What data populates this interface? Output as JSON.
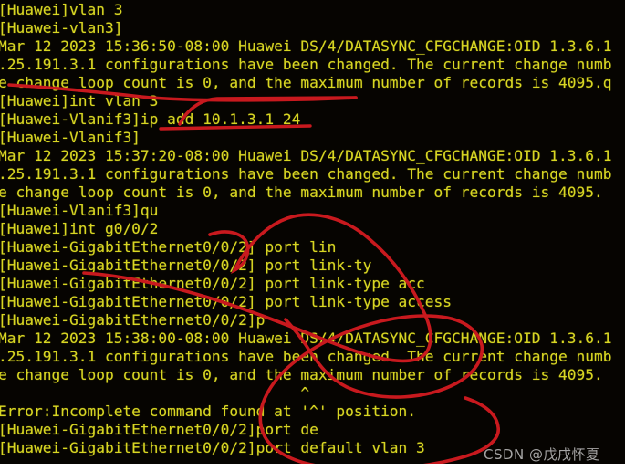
{
  "terminal": {
    "background_color": "#060401",
    "text_color": "#d8d623",
    "annotation_color": "#c8191e",
    "lines": [
      "[Huawei]vlan 3",
      "[Huawei-vlan3]",
      "Mar 12 2023 15:36:50-08:00 Huawei DS/4/DATASYNC_CFGCHANGE:OID 1.3.6.1",
      ".25.191.3.1 configurations have been changed. The current change numb",
      "e change loop count is 0, and the maximum number of records is 4095.q",
      "[Huawei]int vlan 3",
      "[Huawei-Vlanif3]ip add 10.1.3.1 24",
      "[Huawei-Vlanif3]",
      "Mar 12 2023 15:37:20-08:00 Huawei DS/4/DATASYNC_CFGCHANGE:OID 1.3.6.1",
      ".25.191.3.1 configurations have been changed. The current change numb",
      "e change loop count is 0, and the maximum number of records is 4095.",
      "[Huawei-Vlanif3]qu",
      "[Huawei]int g0/0/2",
      "[Huawei-GigabitEthernet0/0/2] port lin",
      "[Huawei-GigabitEthernet0/0/2] port link-ty",
      "[Huawei-GigabitEthernet0/0/2] port link-type acc",
      "[Huawei-GigabitEthernet0/0/2] port link-type access",
      "[Huawei-GigabitEthernet0/0/2]p",
      "Mar 12 2023 15:38:00-08:00 Huawei DS/4/DATASYNC_CFGCHANGE:OID 1.3.6.1",
      ".25.191.3.1 configurations have been changed. The current change numb",
      "e change loop count is 0, and the maximum number of records is 4095.",
      "                                  ^",
      "Error:Incomplete command found at '^' position.",
      "[Huawei-GigabitEthernet0/0/2]port de",
      "[Huawei-GigabitEthernet0/0/2]port default vlan 3"
    ]
  },
  "watermark": {
    "text": "CSDN @戊戌怀夏"
  },
  "annotations": {
    "underline_change_label": "underline-under-change-loop",
    "arrow_label": "arrow-to-int-vlan-3",
    "underline_ipadd_label": "underline-under-ip-add",
    "loop_link_type_label": "circle-around-port-link-type",
    "loop_bottom_label": "circle-around-port-default-vlan"
  }
}
